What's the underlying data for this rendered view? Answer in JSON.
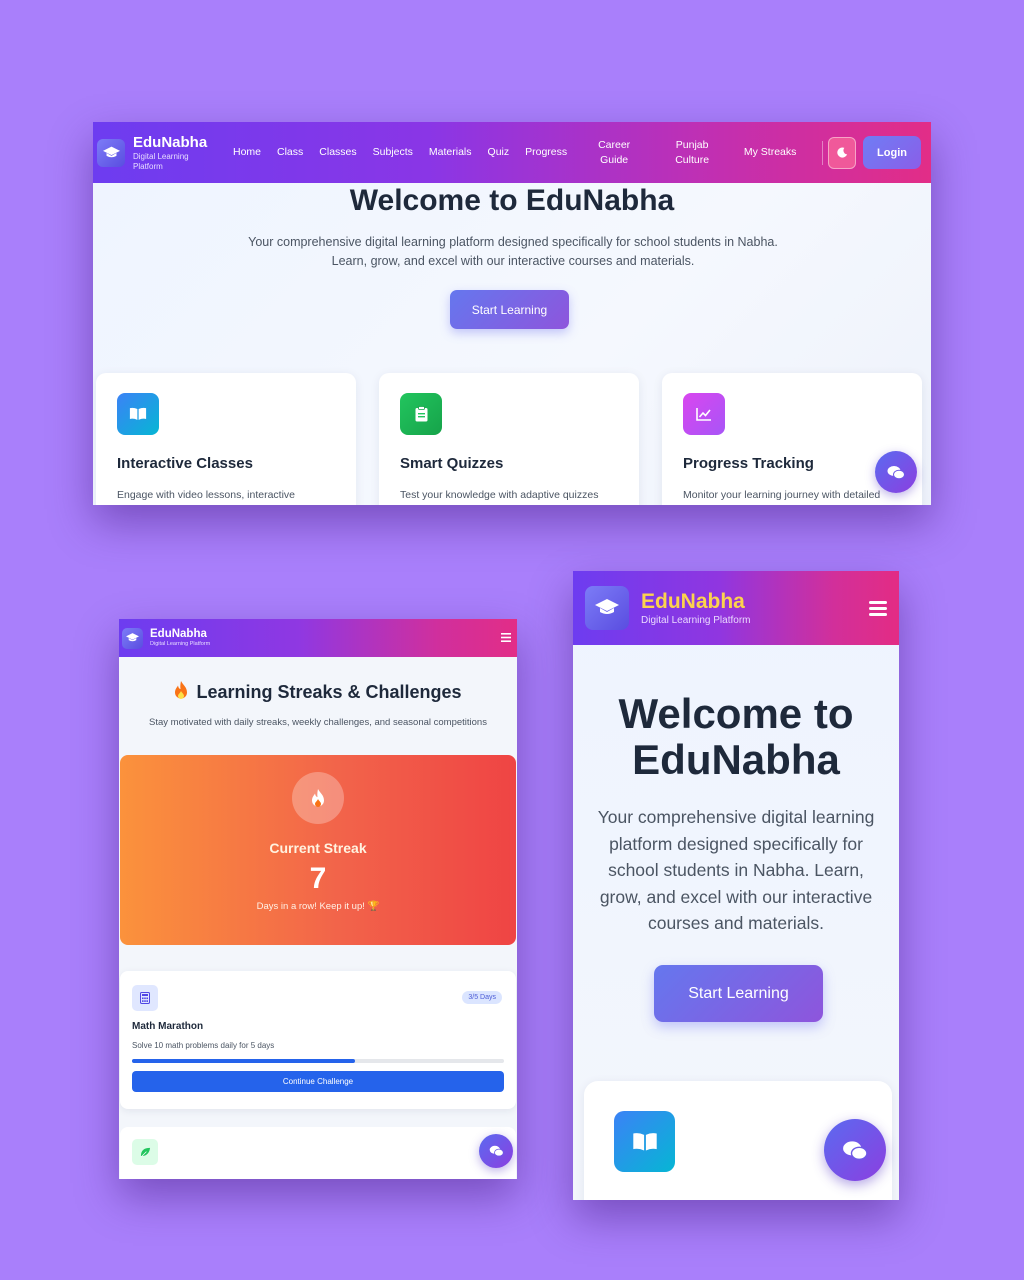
{
  "brand": {
    "name": "EduNabha",
    "tagline": "Digital Learning Platform"
  },
  "colors": {
    "page_background": "#a97ffb",
    "nav_gradient_start": "#6d3cf0",
    "nav_gradient_end": "#e22d87",
    "cta_start": "#6577ee",
    "cta_end": "#8e55dc",
    "streak_start": "#fb923c",
    "streak_end": "#ef4444",
    "primary_button": "#2563eb",
    "mobile_brand_text": "#fcd34d"
  },
  "desktop": {
    "nav": {
      "items": [
        {
          "label": "Home"
        },
        {
          "label": "Class"
        },
        {
          "label": "Classes"
        },
        {
          "label": "Subjects"
        },
        {
          "label": "Materials"
        },
        {
          "label": "Quiz"
        },
        {
          "label": "Progress"
        },
        {
          "label": "Career Guide"
        },
        {
          "label": "Punjab Culture"
        },
        {
          "label": "My Streaks"
        }
      ],
      "theme_icon": "moon-icon",
      "login_label": "Login"
    },
    "hero": {
      "title": "Welcome to EduNabha",
      "subtitle": "Your comprehensive digital learning platform designed specifically for school students in Nabha. Learn, grow, and excel with our interactive courses and materials.",
      "cta_label": "Start Learning"
    },
    "features": [
      {
        "icon": "book-open-icon",
        "color": "#3b82f6",
        "title": "Interactive Classes",
        "desc": "Engage with video lessons, interactive"
      },
      {
        "icon": "clipboard-icon",
        "color": "#22c55e",
        "title": "Smart Quizzes",
        "desc": "Test your knowledge with adaptive quizzes"
      },
      {
        "icon": "chart-line-icon",
        "color": "#d946ef",
        "title": "Progress Tracking",
        "desc": "Monitor your learning journey with detailed"
      }
    ],
    "chat_icon": "chat-bubbles-icon"
  },
  "tablet": {
    "streaks": {
      "title": "Learning Streaks & Challenges",
      "subtitle": "Stay motivated with daily streaks, weekly challenges, and seasonal competitions",
      "current_label": "Current Streak",
      "current_value": "7",
      "message": "Days in a row! Keep it up! 🏆"
    },
    "challenge": {
      "icon": "calculator-icon",
      "badge": "3/5 Days",
      "title": "Math Marathon",
      "desc": "Solve 10 math problems daily for 5 days",
      "progress": 0.6,
      "button_label": "Continue Challenge"
    },
    "next_card_icon": "leaf-icon"
  },
  "mobile": {
    "hero": {
      "title": "Welcome to EduNabha",
      "subtitle": "Your comprehensive digital learning platform designed specifically for school students in Nabha. Learn, grow, and excel with our interactive courses and materials.",
      "cta_label": "Start Learning"
    },
    "menu_icon": "hamburger-icon"
  }
}
